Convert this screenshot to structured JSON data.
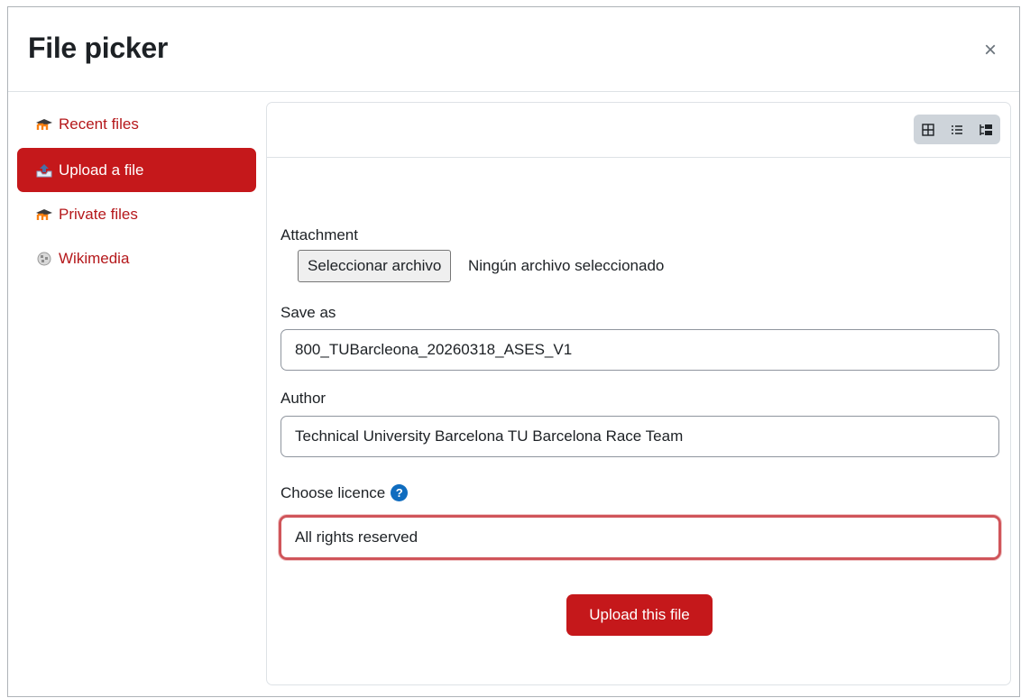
{
  "dialog": {
    "title": "File picker",
    "close_glyph": "×"
  },
  "sidebar": {
    "items": [
      {
        "label": "Recent files",
        "icon": "moodle-icon",
        "active": false
      },
      {
        "label": "Upload a file",
        "icon": "upload-icon",
        "active": true
      },
      {
        "label": "Private files",
        "icon": "moodle-icon",
        "active": false
      },
      {
        "label": "Wikimedia",
        "icon": "wikimedia-icon",
        "active": false
      }
    ]
  },
  "toolbar": {
    "views": [
      "grid-view-icon",
      "list-view-icon",
      "tree-view-icon"
    ]
  },
  "form": {
    "attachment_label": "Attachment",
    "choose_file_button": "Seleccionar archivo",
    "no_file_text": "Ningún archivo seleccionado",
    "save_as_label": "Save as",
    "save_as_value": "800_TUBarcleona_20260318_ASES_V1",
    "author_label": "Author",
    "author_value": "Technical University Barcelona TU Barcelona Race Team",
    "licence_label": "Choose licence",
    "licence_help": "?",
    "licence_value": "All rights reserved",
    "upload_button": "Upload this file"
  },
  "colors": {
    "brand": "#c5181b",
    "link": "#b5181b",
    "help": "#0f6cbf",
    "focus_border": "#d0555a"
  }
}
